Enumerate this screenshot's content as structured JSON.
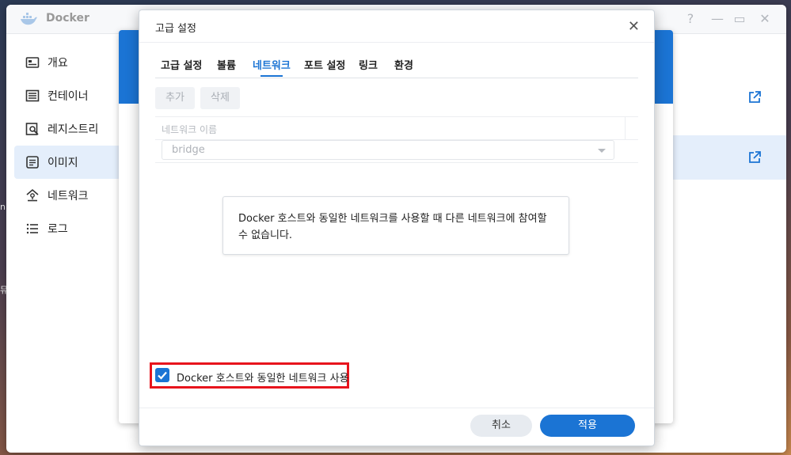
{
  "app": {
    "title": "Docker",
    "controls": {
      "help": "?",
      "minimize": "—",
      "maximize": "▭",
      "close": "✕"
    }
  },
  "sidebar": {
    "items": [
      {
        "label": "개요",
        "icon": "overview-icon"
      },
      {
        "label": "컨테이너",
        "icon": "container-icon"
      },
      {
        "label": "레지스트리",
        "icon": "registry-icon"
      },
      {
        "label": "이미지",
        "icon": "image-icon",
        "active": true
      },
      {
        "label": "네트워크",
        "icon": "network-icon"
      },
      {
        "label": "로그",
        "icon": "log-icon"
      }
    ]
  },
  "dialog": {
    "title": "고급 설정",
    "close": "✕",
    "tabs": [
      {
        "label": "고급 설정"
      },
      {
        "label": "볼륨"
      },
      {
        "label": "네트워크",
        "active": true
      },
      {
        "label": "포트 설정"
      },
      {
        "label": "링크"
      },
      {
        "label": "환경"
      }
    ],
    "add_button": "추가",
    "delete_button": "삭제",
    "network_column": "네트워크 이름",
    "network_value": "bridge",
    "info_message": "Docker 호스트와 동일한 네트워크를 사용할 때 다른 네트워크에 참여할 수 없습니다.",
    "host_network_checkbox": {
      "label": "Docker 호스트와 동일한 네트워크 사용",
      "checked": true
    },
    "cancel_button": "취소",
    "apply_button": "적용"
  },
  "edge_fragments": [
    "n",
    "뮤"
  ],
  "colors": {
    "accent": "#1b74d4",
    "highlight": "#e8141c"
  }
}
